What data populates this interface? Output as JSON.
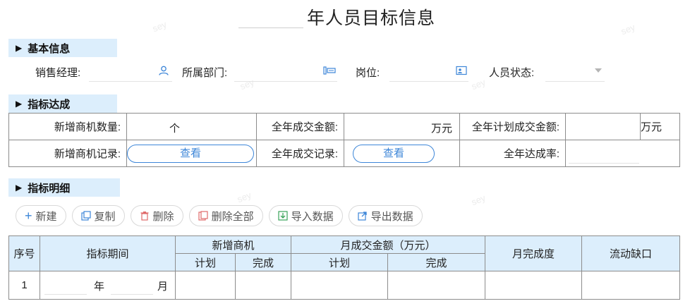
{
  "title": {
    "year_value": "",
    "text": "年人员目标信息"
  },
  "sections": {
    "basic": "基本信息",
    "target": "指标达成",
    "detail": "指标明细"
  },
  "basic": {
    "sales_manager_label": "销售经理:",
    "department_label": "所属部门:",
    "position_label": "岗位:",
    "status_label": "人员状态:"
  },
  "target": {
    "new_opps_label": "新增商机数量:",
    "new_opps_unit": "个",
    "annual_deal_label": "全年成交金额:",
    "annual_deal_unit": "万元",
    "annual_plan_label": "全年计划成交金额:",
    "annual_plan_unit": "万元",
    "new_opps_record_label": "新增商机记录:",
    "view_label": "查看",
    "annual_deal_record_label": "全年成交记录:",
    "annual_rate_label": "全年达成率:"
  },
  "toolbar": {
    "new": "新建",
    "copy": "复制",
    "delete": "删除",
    "delete_all": "删除全部",
    "import": "导入数据",
    "export": "导出数据"
  },
  "detail_table": {
    "col_index": "序号",
    "col_period": "指标期间",
    "col_new_opps": "新增商机",
    "col_monthly_amount": "月成交金额（万元）",
    "col_monthly_rate": "月完成度",
    "col_gap": "流动缺口",
    "sub_plan": "计划",
    "sub_done": "完成",
    "rows": [
      {
        "index": "1",
        "year_suffix": "年",
        "month_suffix": "月"
      }
    ]
  },
  "watermark": "sey",
  "colors": {
    "section_bg": "#dceefc",
    "accent": "#3d86d8",
    "border": "#8c8c8c"
  }
}
